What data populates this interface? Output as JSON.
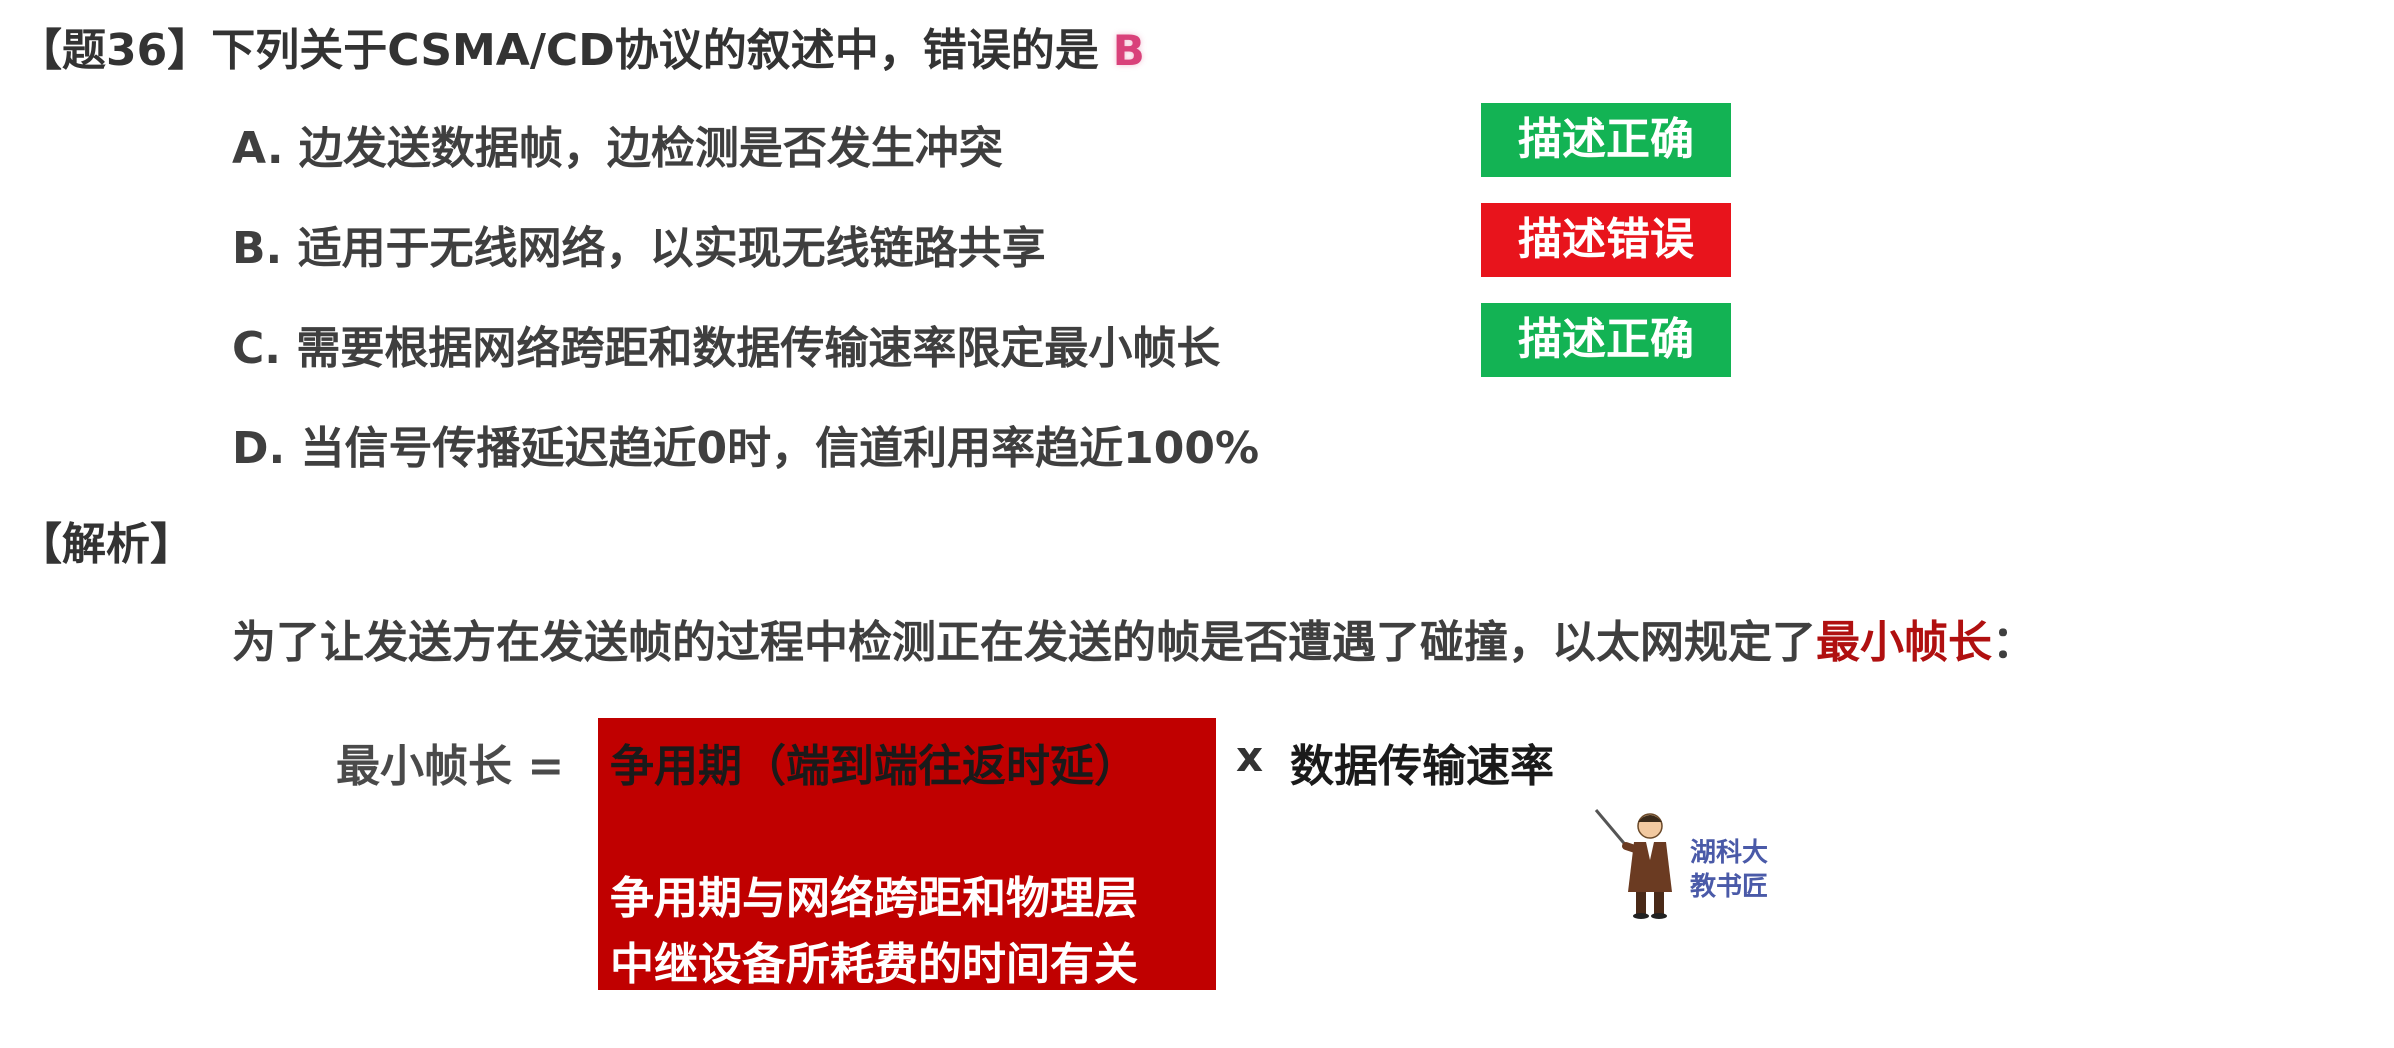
{
  "question": {
    "title": "【题36】下列关于CSMA/CD协议的叙述中，错误的是",
    "answer": "B",
    "options": [
      {
        "text": "A. 边发送数据帧，边检测是否发生冲突",
        "verdict": "描述正确",
        "verdict_color": "#13b354"
      },
      {
        "text": "B. 适用于无线网络，以实现无线链路共享",
        "verdict": "描述错误",
        "verdict_color": "#e8141c"
      },
      {
        "text": "C. 需要根据网络跨距和数据传输速率限定最小帧长",
        "verdict": "描述正确",
        "verdict_color": "#13b354"
      },
      {
        "text": "D. 当信号传播延迟趋近0时，信道利用率趋近100%"
      }
    ]
  },
  "analysis": {
    "heading": "【解析】",
    "explanation_prefix": "为了让发送方在发送帧的过程中检测正在发送的帧是否遭遇了碰撞，以太网规定了",
    "explanation_highlight": "最小帧长",
    "explanation_suffix": "：",
    "highlight_color": "#b01010",
    "formula": {
      "left": "最小帧长 =",
      "box_title": "争用期（端到端往返时延）",
      "box_note_line1": "争用期与网络跨距和物理层",
      "box_note_line2": "中继设备所耗费的时间有关",
      "box_color": "#c00000",
      "operator": "x",
      "right": "数据传输速率"
    }
  },
  "watermark": {
    "line1": "湖科大",
    "line2": "教书匠",
    "icon": "teacher-mascot-icon"
  }
}
